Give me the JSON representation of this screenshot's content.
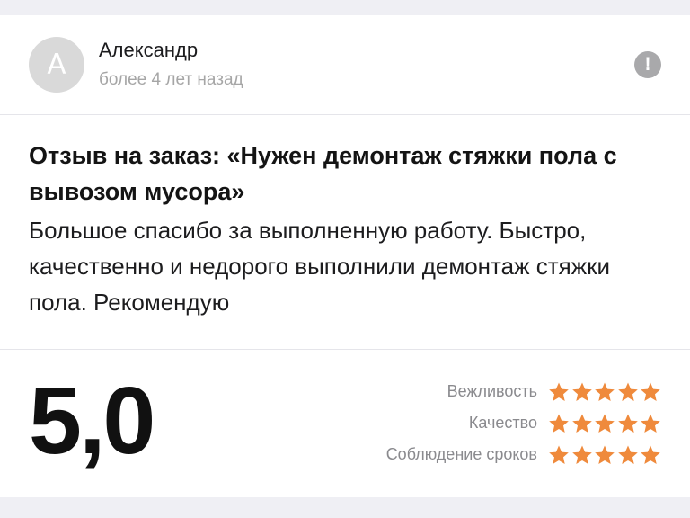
{
  "author": {
    "avatar_letter": "А",
    "name": "Александр",
    "time": "более 4 лет назад",
    "report_icon": "exclamation-icon",
    "report_symbol": "!"
  },
  "review": {
    "title": "Отзыв на заказ: «Нужен демонтаж стяжки пола с вывозом мусора»",
    "text": "Большое спасибо за выполненную работу. Быстро, качественно и недорого выполнили демонтаж стяжки пола. Рекомендую"
  },
  "rating": {
    "score": "5,0",
    "star_color": "#ef8a3c",
    "criteria": [
      {
        "label": "Вежливость",
        "stars": 5
      },
      {
        "label": "Качество",
        "stars": 5
      },
      {
        "label": "Соблюдение сроков",
        "stars": 5
      }
    ]
  }
}
